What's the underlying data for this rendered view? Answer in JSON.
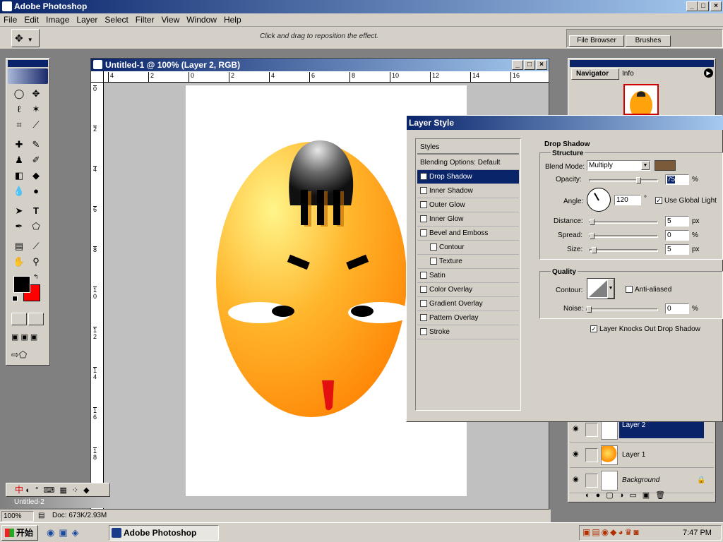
{
  "app": {
    "title": "Adobe Photoshop",
    "win_min": "_",
    "win_max": "□",
    "win_close": "×"
  },
  "menu": [
    "File",
    "Edit",
    "Image",
    "Layer",
    "Select",
    "Filter",
    "View",
    "Window",
    "Help"
  ],
  "options": {
    "hint": "Click and drag to reposition the effect.",
    "tab_file_browser": "File Browser",
    "tab_brushes": "Brushes"
  },
  "document": {
    "title": "Untitled-1 @ 100% (Layer 2, RGB)",
    "ruler_h": [
      "4",
      "2",
      "0",
      "2",
      "4",
      "6",
      "8",
      "10",
      "12",
      "14",
      "16"
    ],
    "ruler_v": [
      "0",
      "2",
      "4",
      "6",
      "8",
      "1\n0",
      "1\n2",
      "1\n4",
      "1\n6",
      "1\n8"
    ]
  },
  "navigator": {
    "tab_navigator": "Navigator",
    "tab_info": "Info"
  },
  "dialog": {
    "title": "Layer Style",
    "styles_header": "Styles",
    "blending": "Blending Options: Default",
    "items": [
      {
        "label": "Drop Shadow",
        "checked": true,
        "selected": true,
        "indent": false
      },
      {
        "label": "Inner Shadow",
        "checked": false,
        "selected": false,
        "indent": false
      },
      {
        "label": "Outer Glow",
        "checked": false,
        "selected": false,
        "indent": false
      },
      {
        "label": "Inner Glow",
        "checked": false,
        "selected": false,
        "indent": false
      },
      {
        "label": "Bevel and Emboss",
        "checked": false,
        "selected": false,
        "indent": false
      },
      {
        "label": "Contour",
        "checked": false,
        "selected": false,
        "indent": true
      },
      {
        "label": "Texture",
        "checked": false,
        "selected": false,
        "indent": true
      },
      {
        "label": "Satin",
        "checked": false,
        "selected": false,
        "indent": false
      },
      {
        "label": "Color Overlay",
        "checked": false,
        "selected": false,
        "indent": false
      },
      {
        "label": "Gradient Overlay",
        "checked": false,
        "selected": false,
        "indent": false
      },
      {
        "label": "Pattern Overlay",
        "checked": false,
        "selected": false,
        "indent": false
      },
      {
        "label": "Stroke",
        "checked": false,
        "selected": false,
        "indent": false
      }
    ],
    "section": "Drop Shadow",
    "structure": "Structure",
    "blend_mode_label": "Blend Mode:",
    "blend_mode": "Multiply",
    "shadow_color": "#7a5a38",
    "opacity_label": "Opacity:",
    "opacity": "75",
    "opacity_level": 0.75,
    "angle_label": "Angle:",
    "angle": "120",
    "degree": "°",
    "global_light": "Use Global Light",
    "distance_label": "Distance:",
    "distance": "5",
    "distance_level": 0.0,
    "spread_label": "Spread:",
    "spread": "0",
    "spread_level": 0.0,
    "size_label": "Size:",
    "size": "5",
    "size_level": 0.03,
    "unit_px": "px",
    "unit_pct": "%",
    "quality": "Quality",
    "contour_label": "Contour:",
    "anti_aliased": "Anti-aliased",
    "noise_label": "Noise:",
    "noise": "0",
    "noise_level": 0.0,
    "knocks_out": "Layer Knocks Out Drop Shadow"
  },
  "layers": [
    {
      "name": "Layer 2",
      "selected": true,
      "italic": false
    },
    {
      "name": "Layer 1",
      "selected": false,
      "italic": false
    },
    {
      "name": "Background",
      "selected": false,
      "italic": true
    }
  ],
  "status": {
    "zoom": "100%",
    "doc": "Doc: 673K/2.93M",
    "minimized": "Untitled-2"
  },
  "ime": {
    "text": "中"
  },
  "taskbar": {
    "start": "开始",
    "task": "Adobe Photoshop",
    "clock": "7:47 PM"
  }
}
